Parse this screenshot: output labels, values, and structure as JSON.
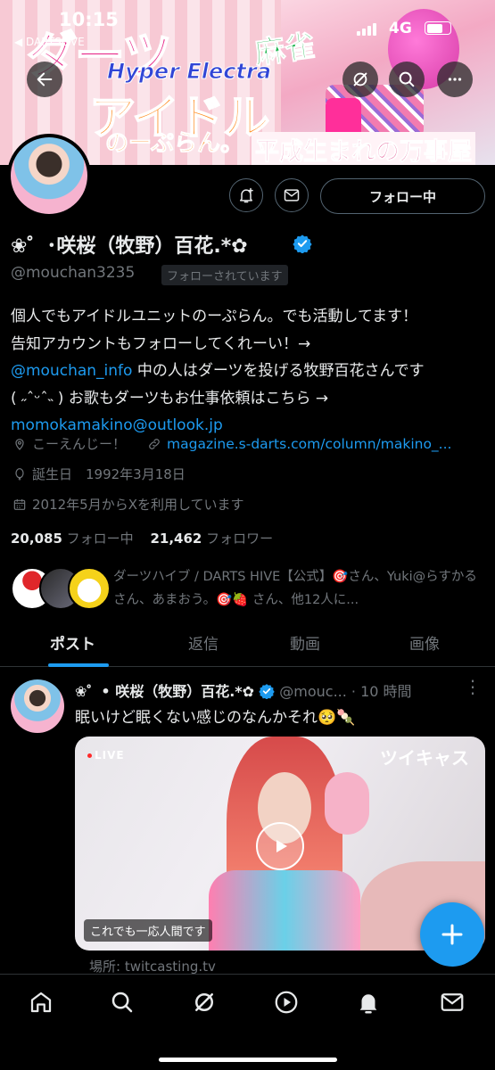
{
  "status_bar": {
    "time": "10:15",
    "back_app": "◀ DARTSLIVE",
    "network": "4G"
  },
  "banner": {
    "title_darts": "ダーツ",
    "title_mahjong": "麻雀",
    "title_hyper": "Hyper Electra",
    "title_idol": "アイドル",
    "title_noplan": "のーぷらん。",
    "title_heisei": "平成生まれの万事屋"
  },
  "header_icons": {
    "back": "arrow-left-icon",
    "grok": "grok-icon",
    "search": "search-icon",
    "more": "more-icon"
  },
  "profile": {
    "follow_button": "フォロー中",
    "display_name": "❀゜･咲桜（牧野）百花.*✿",
    "handle": "@mouchan3235",
    "follows_you": "フォローされています",
    "bio_line1": "個人でもアイドルユニットのーぷらん。でも活動してます！",
    "bio_line2": "告知アカウントもフォローしてくれーい！→",
    "bio_mention": "@mouchan_info",
    "bio_line3_rest": " 中の人はダーツを投げる牧野百花さんです",
    "bio_line4": "( ˶ˆᵕˆ˵ ) お歌もダーツもお仕事依頼はこちら →",
    "bio_email": "momokamakino@outlook.jp",
    "location": "こーえんじー！",
    "website": "magazine.s-darts.com/column/makino_...",
    "birthday": "誕生日　1992年3月18日",
    "joined": "2012年5月からXを利用しています",
    "following_count": "20,085",
    "following_label": "フォロー中",
    "followers_count": "21,462",
    "followers_label": "フォロワー",
    "followed_by": "ダーツハイブ / DARTS HIVE【公式】🎯さん、Yuki@らすかるさん、あまおう。🎯🍓 さん、他12人に..."
  },
  "tabs": [
    {
      "label": "ポスト",
      "active": true
    },
    {
      "label": "返信",
      "active": false
    },
    {
      "label": "動画",
      "active": false
    },
    {
      "label": "画像",
      "active": false
    }
  ],
  "post": {
    "name": "❀゜• 咲桜（牧野）百花.*✿",
    "handle": "@mouc...",
    "time": "· 10 時間",
    "text": "眠いけど眠くない感じのなんかそれ🥺🍡",
    "media_live": "LIVE",
    "media_brand": "ツイキャス",
    "media_caption": "これでも一応人間です",
    "source": "場所: twitcasting.tv"
  },
  "colors": {
    "accent": "#1d9bf0",
    "muted": "#71767b",
    "text": "#e7e9ea",
    "background": "#000000"
  },
  "bottom_nav": [
    "home-icon",
    "search-icon",
    "grok-icon",
    "play-icon",
    "notifications-icon",
    "messages-icon"
  ]
}
